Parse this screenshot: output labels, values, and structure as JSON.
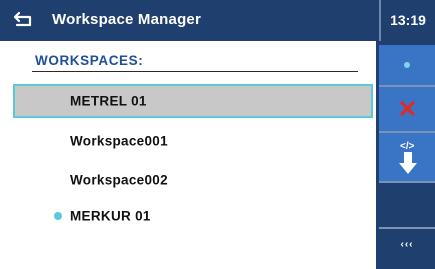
{
  "header": {
    "title": "Workspace Manager",
    "time": "13:19"
  },
  "section": {
    "title": "WORKSPACES:"
  },
  "workspaces": [
    {
      "name": "METREL 01",
      "selected": true,
      "active": false
    },
    {
      "name": "Workspace001",
      "selected": false,
      "active": false
    },
    {
      "name": "Workspace002",
      "selected": false,
      "active": false
    },
    {
      "name": "MERKUR 01",
      "selected": false,
      "active": true
    }
  ],
  "sidebar": {
    "buttons": [
      "dot-icon",
      "delete-icon",
      "import-export-icon",
      "empty",
      "more-icon"
    ],
    "more_label": "‹‹‹"
  },
  "colors": {
    "header_bg": "#1f3f6e",
    "button_blue": "#3a74c5",
    "selection_border": "#5cc9d8",
    "selection_bg": "#c8c8c8",
    "section_text": "#1f4f98",
    "active_dot": "#5bc7e0",
    "delete_red": "#e02a2a"
  }
}
